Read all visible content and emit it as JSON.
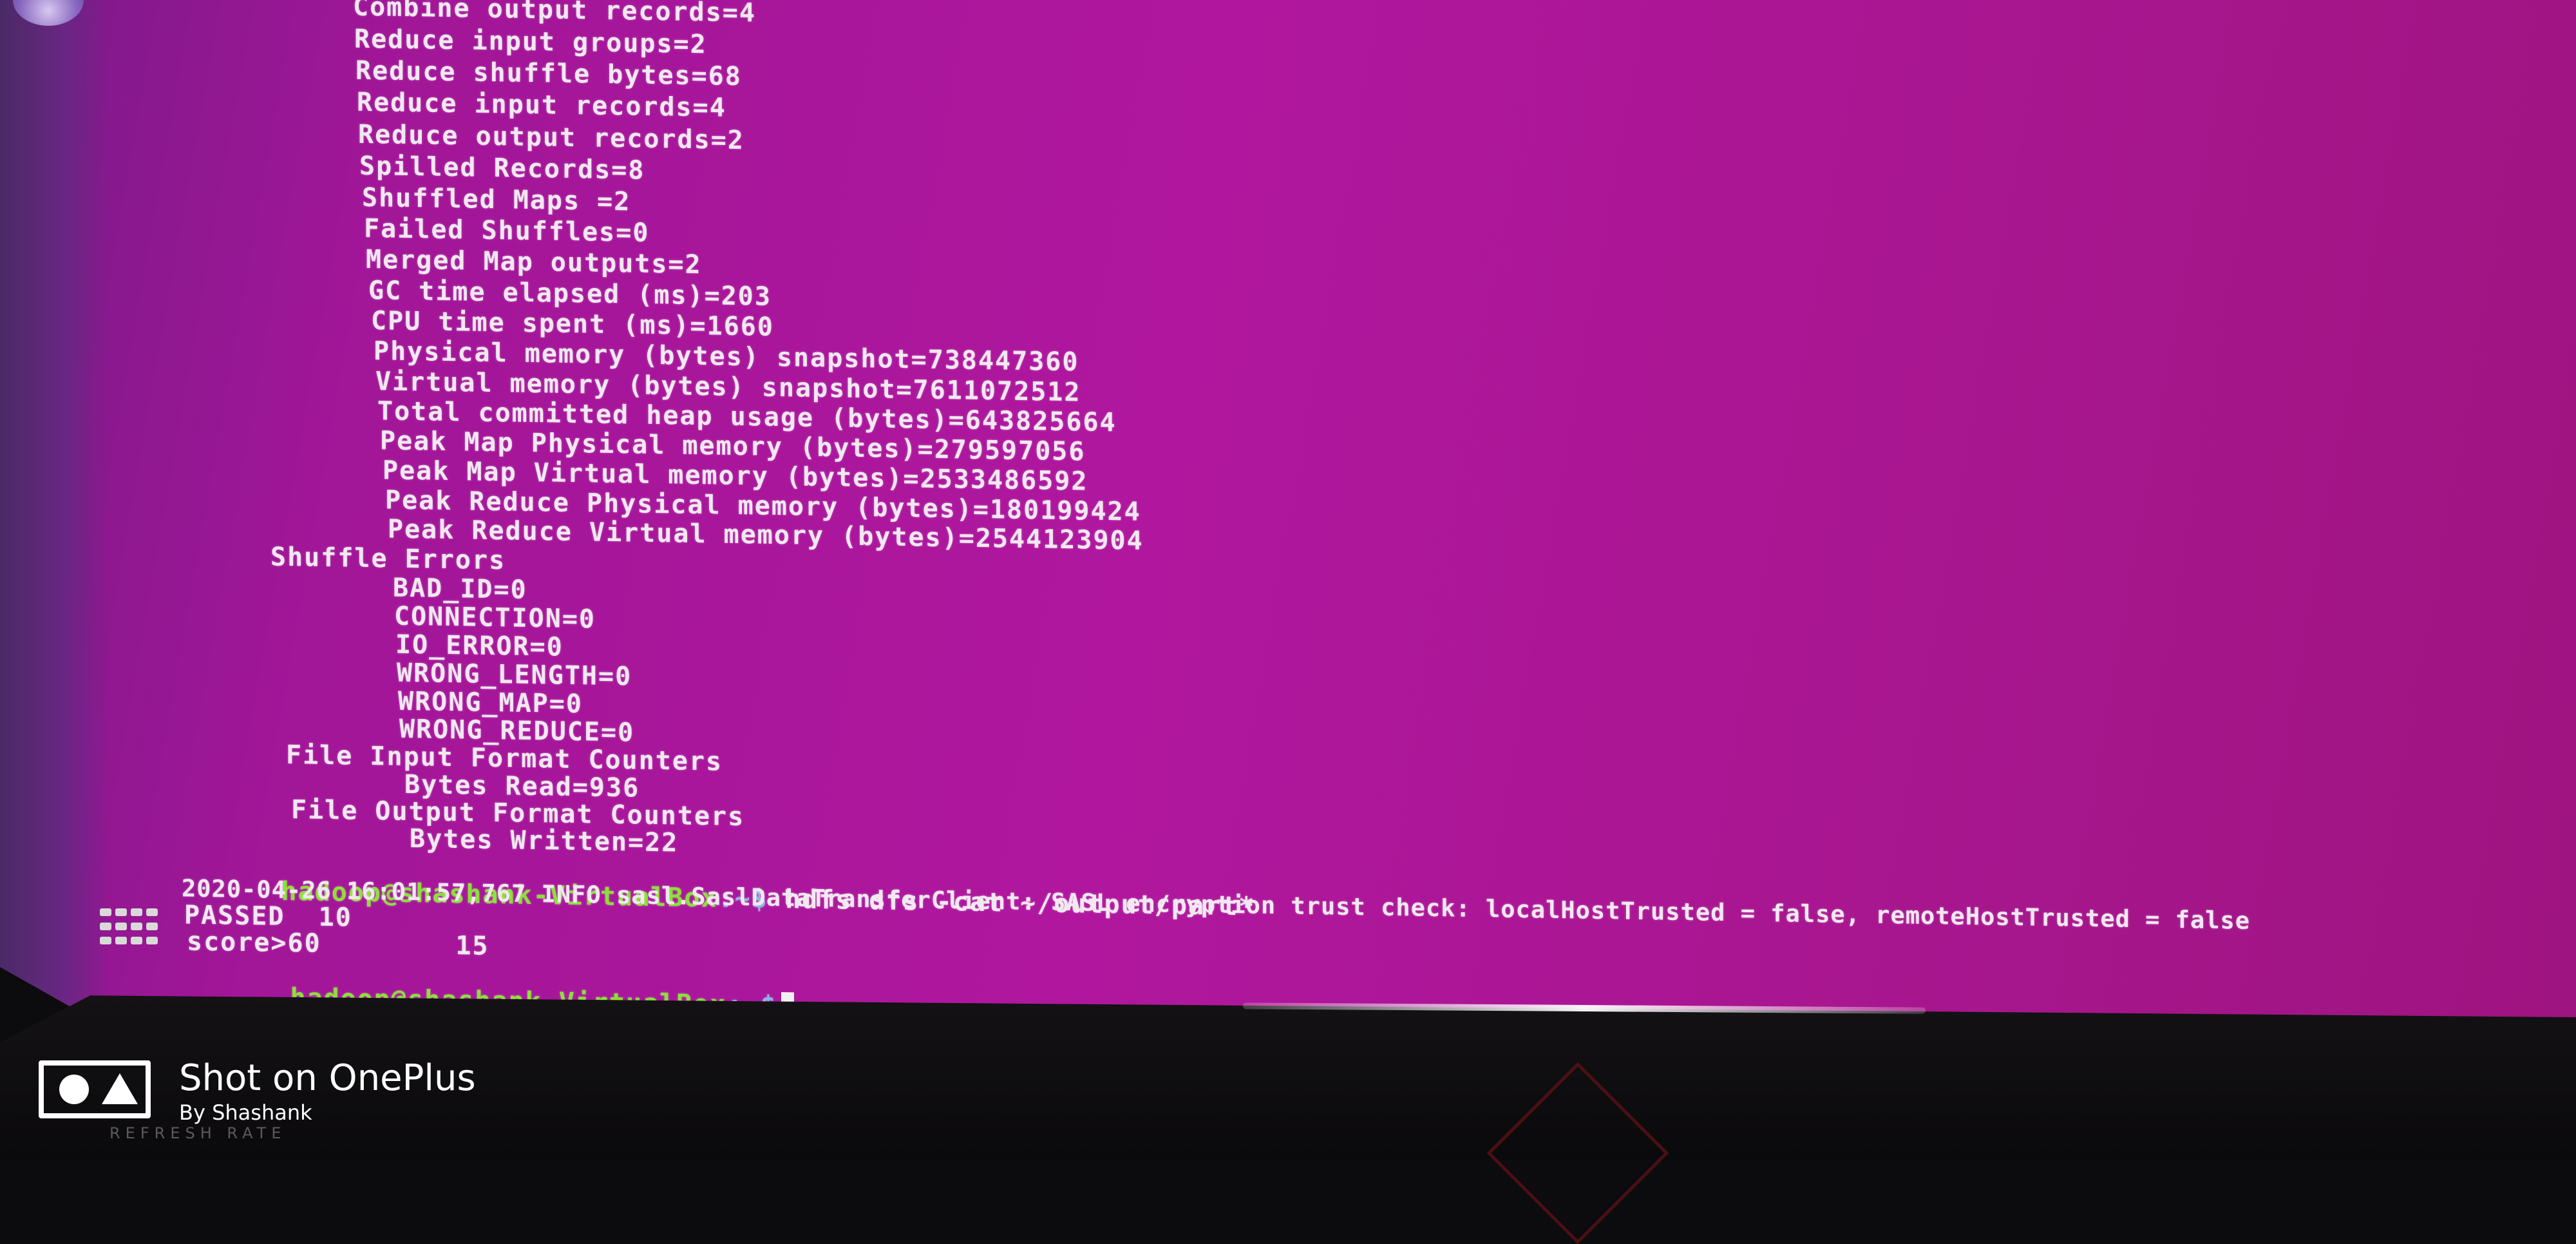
{
  "terminal": {
    "lines": [
      "Combine output records=4",
      "Reduce input groups=2",
      "Reduce shuffle bytes=68",
      "Reduce input records=4",
      "Reduce output records=2",
      "Spilled Records=8",
      "Shuffled Maps =2",
      "Failed Shuffles=0",
      "Merged Map outputs=2",
      "GC time elapsed (ms)=203",
      "CPU time spent (ms)=1660",
      "Physical memory (bytes) snapshot=738447360",
      "Virtual memory (bytes) snapshot=7611072512",
      "Total committed heap usage (bytes)=643825664",
      "Peak Map Physical memory (bytes)=279597056",
      "Peak Map Virtual memory (bytes)=2533486592",
      "Peak Reduce Physical memory (bytes)=180199424",
      "Peak Reduce Virtual memory (bytes)=2544123904",
      "Shuffle Errors",
      "BAD_ID=0",
      "CONNECTION=0",
      "IO_ERROR=0",
      "WRONG_LENGTH=0",
      "WRONG_MAP=0",
      "WRONG_REDUCE=0",
      "File Input Format Counters",
      "Bytes Read=936",
      "File Output Format Counters",
      "Bytes Written=22"
    ],
    "prompt1": {
      "user": "hadoop@shashank-VirtualBox",
      "path": ":~$",
      "command": " hdfs dfs -cat ~/output/part*"
    },
    "log_line": "2020-04-26 16:01:57,767 INFO sasl.SaslDataTransferClient: SASL encryption trust check: localHostTrusted = false, remoteHostTrusted = false",
    "output_rows": [
      "PASSED  10",
      "score>60        15"
    ],
    "prompt2": {
      "user": "hadoop@shashank-VirtualBox",
      "path": ":~$"
    }
  },
  "watermark": {
    "title": "Shot on OnePlus",
    "subtitle": "By Shashank"
  },
  "bezel": {
    "brand_text": "REFRESH RATE"
  },
  "icons": {
    "dock": "ubuntu-dock-icon",
    "apps": "show-applications-grid-icon",
    "camera": "oneplus-camera-logo-icon"
  }
}
